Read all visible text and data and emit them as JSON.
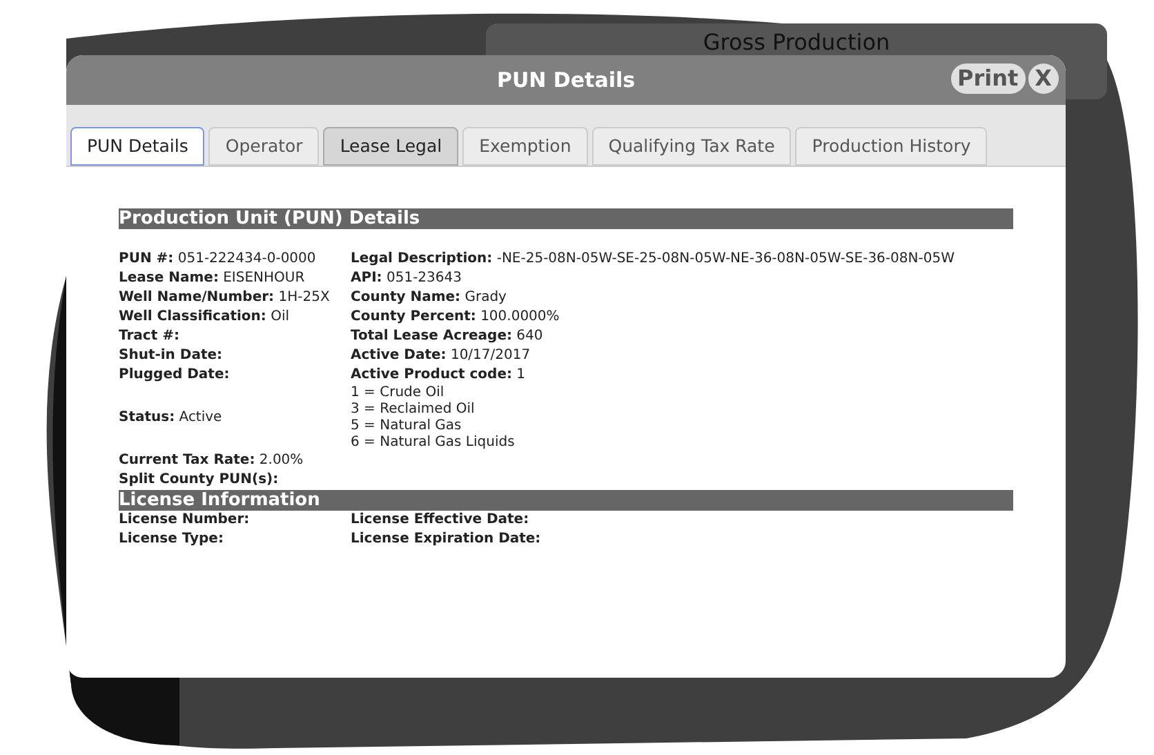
{
  "background_window": {
    "title": "Gross Production"
  },
  "dialog": {
    "title": "PUN Details",
    "buttons": [
      "Print",
      "X"
    ]
  },
  "tabs": [
    {
      "label": "PUN Details",
      "selected": true,
      "hovered": false
    },
    {
      "label": "Operator",
      "selected": false,
      "hovered": false
    },
    {
      "label": "Lease Legal",
      "selected": false,
      "hovered": true
    },
    {
      "label": "Exemption",
      "selected": false,
      "hovered": false
    },
    {
      "label": "Qualifying Tax Rate",
      "selected": false,
      "hovered": false
    },
    {
      "label": "Production History",
      "selected": false,
      "hovered": false
    }
  ],
  "sections": [
    {
      "title": "Production Unit (PUN) Details",
      "rows": [
        {
          "left": {
            "label": "PUN #:",
            "value": "051-222434-0-0000"
          },
          "right": {
            "label": "Legal Description:",
            "value": "-NE-25-08N-05W-SE-25-08N-05W-NE-36-08N-05W-SE-36-08N-05W"
          }
        },
        {
          "left": {
            "label": "Lease Name:",
            "value": "EISENHOUR"
          },
          "right": {
            "label": "API:",
            "value": "051-23643"
          }
        },
        {
          "left": {
            "label": "Well Name/Number:",
            "value": "1H-25X"
          },
          "right": {
            "label": "County Name:",
            "value": "Grady"
          }
        },
        {
          "left": {
            "label": "Well Classification:",
            "value": "Oil"
          },
          "right": {
            "label": "County Percent:",
            "value": "100.0000%"
          }
        },
        {
          "left": {
            "label": "Tract #:"
          },
          "right": {
            "label": "Total Lease Acreage:",
            "value": "640"
          }
        },
        {
          "left": {
            "label": "Shut-in Date:"
          },
          "right": {
            "label": "Active Date:",
            "value": "10/17/2017"
          }
        },
        {
          "left": {
            "label": "Plugged Date:"
          },
          "right": {
            "label": "Active Product code:",
            "value": "1"
          }
        },
        {
          "left": {
            "label": "Status:",
            "value": "Active"
          },
          "right_lines": [
            "1 = Crude Oil",
            "3 = Reclaimed Oil",
            "5 = Natural Gas",
            "6 = Natural Gas Liquids"
          ]
        },
        {
          "left": {
            "label": "Current Tax Rate:",
            "value": "2.00%"
          }
        },
        {
          "left": {
            "label": "Split County PUN(s):"
          }
        }
      ]
    },
    {
      "title": "License Information",
      "rows": [
        {
          "left": {
            "label": "License Number:"
          },
          "right": {
            "label": "License Effective Date:"
          }
        },
        {
          "left": {
            "label": "License Type:"
          },
          "right": {
            "label": "License Expiration Date:"
          }
        }
      ]
    }
  ]
}
